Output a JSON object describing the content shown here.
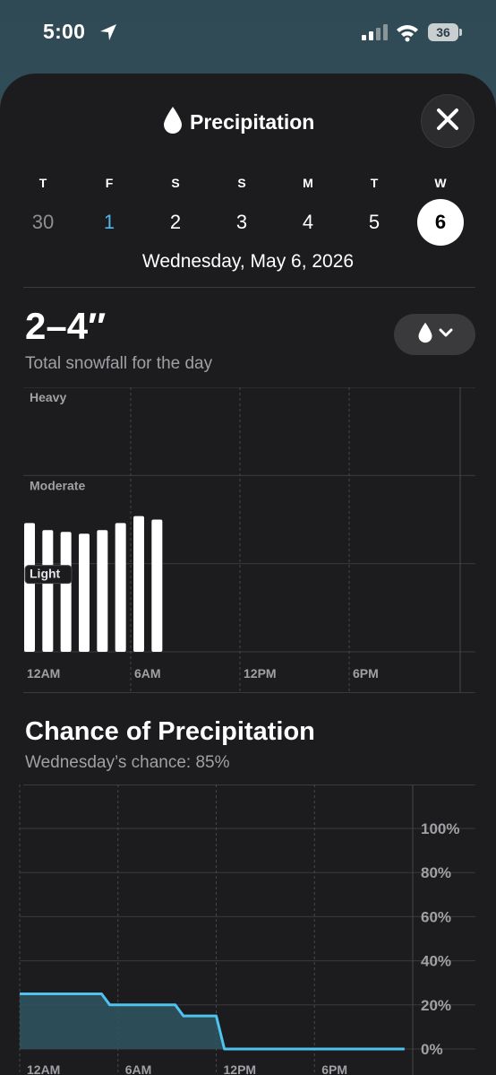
{
  "status_bar": {
    "time": "5:00",
    "battery": "36"
  },
  "header": {
    "title": "Precipitation",
    "icon": "raindrop-icon",
    "close_icon": "close-icon"
  },
  "days": [
    {
      "dow": "T",
      "num": "30",
      "state": "past"
    },
    {
      "dow": "F",
      "num": "1",
      "state": "today"
    },
    {
      "dow": "S",
      "num": "2",
      "state": "normal"
    },
    {
      "dow": "S",
      "num": "3",
      "state": "normal"
    },
    {
      "dow": "M",
      "num": "4",
      "state": "normal"
    },
    {
      "dow": "T",
      "num": "5",
      "state": "normal"
    },
    {
      "dow": "W",
      "num": "6",
      "state": "selected"
    }
  ],
  "selected_date": "Wednesday, May 6, 2026",
  "snowfall": {
    "amount": "2–4″",
    "subtitle": "Total snowfall for the day",
    "type_button_icon": "raindrop-icon"
  },
  "chance": {
    "title": "Chance of Precipitation",
    "subtitle": "Wednesday’s chance: 85%"
  },
  "chart_data": [
    {
      "type": "bar",
      "y_levels": [
        "Heavy",
        "Moderate",
        "Light"
      ],
      "x_ticks": [
        "12AM",
        "6AM",
        "12PM",
        "6PM"
      ],
      "hours": [
        0,
        1,
        2,
        3,
        4,
        5,
        6,
        7
      ],
      "values": [
        0.73,
        0.69,
        0.68,
        0.67,
        0.69,
        0.73,
        0.77,
        0.75
      ],
      "ylim": [
        0,
        1.5
      ],
      "grid": true,
      "bar_color": "#ffffff"
    },
    {
      "type": "area",
      "x_ticks": [
        "12AM",
        "6AM",
        "12PM",
        "6PM"
      ],
      "y_ticks": [
        "100%",
        "80%",
        "60%",
        "40%",
        "20%",
        "0%"
      ],
      "x_hours": [
        0,
        5,
        5.5,
        9.5,
        10,
        12,
        12.5,
        23.5
      ],
      "values": [
        25,
        25,
        20,
        20,
        15,
        15,
        0,
        0
      ],
      "ylim": [
        0,
        100
      ],
      "line_color": "#4fc3ee",
      "fill_color": "#2f5662",
      "grid": true
    }
  ]
}
